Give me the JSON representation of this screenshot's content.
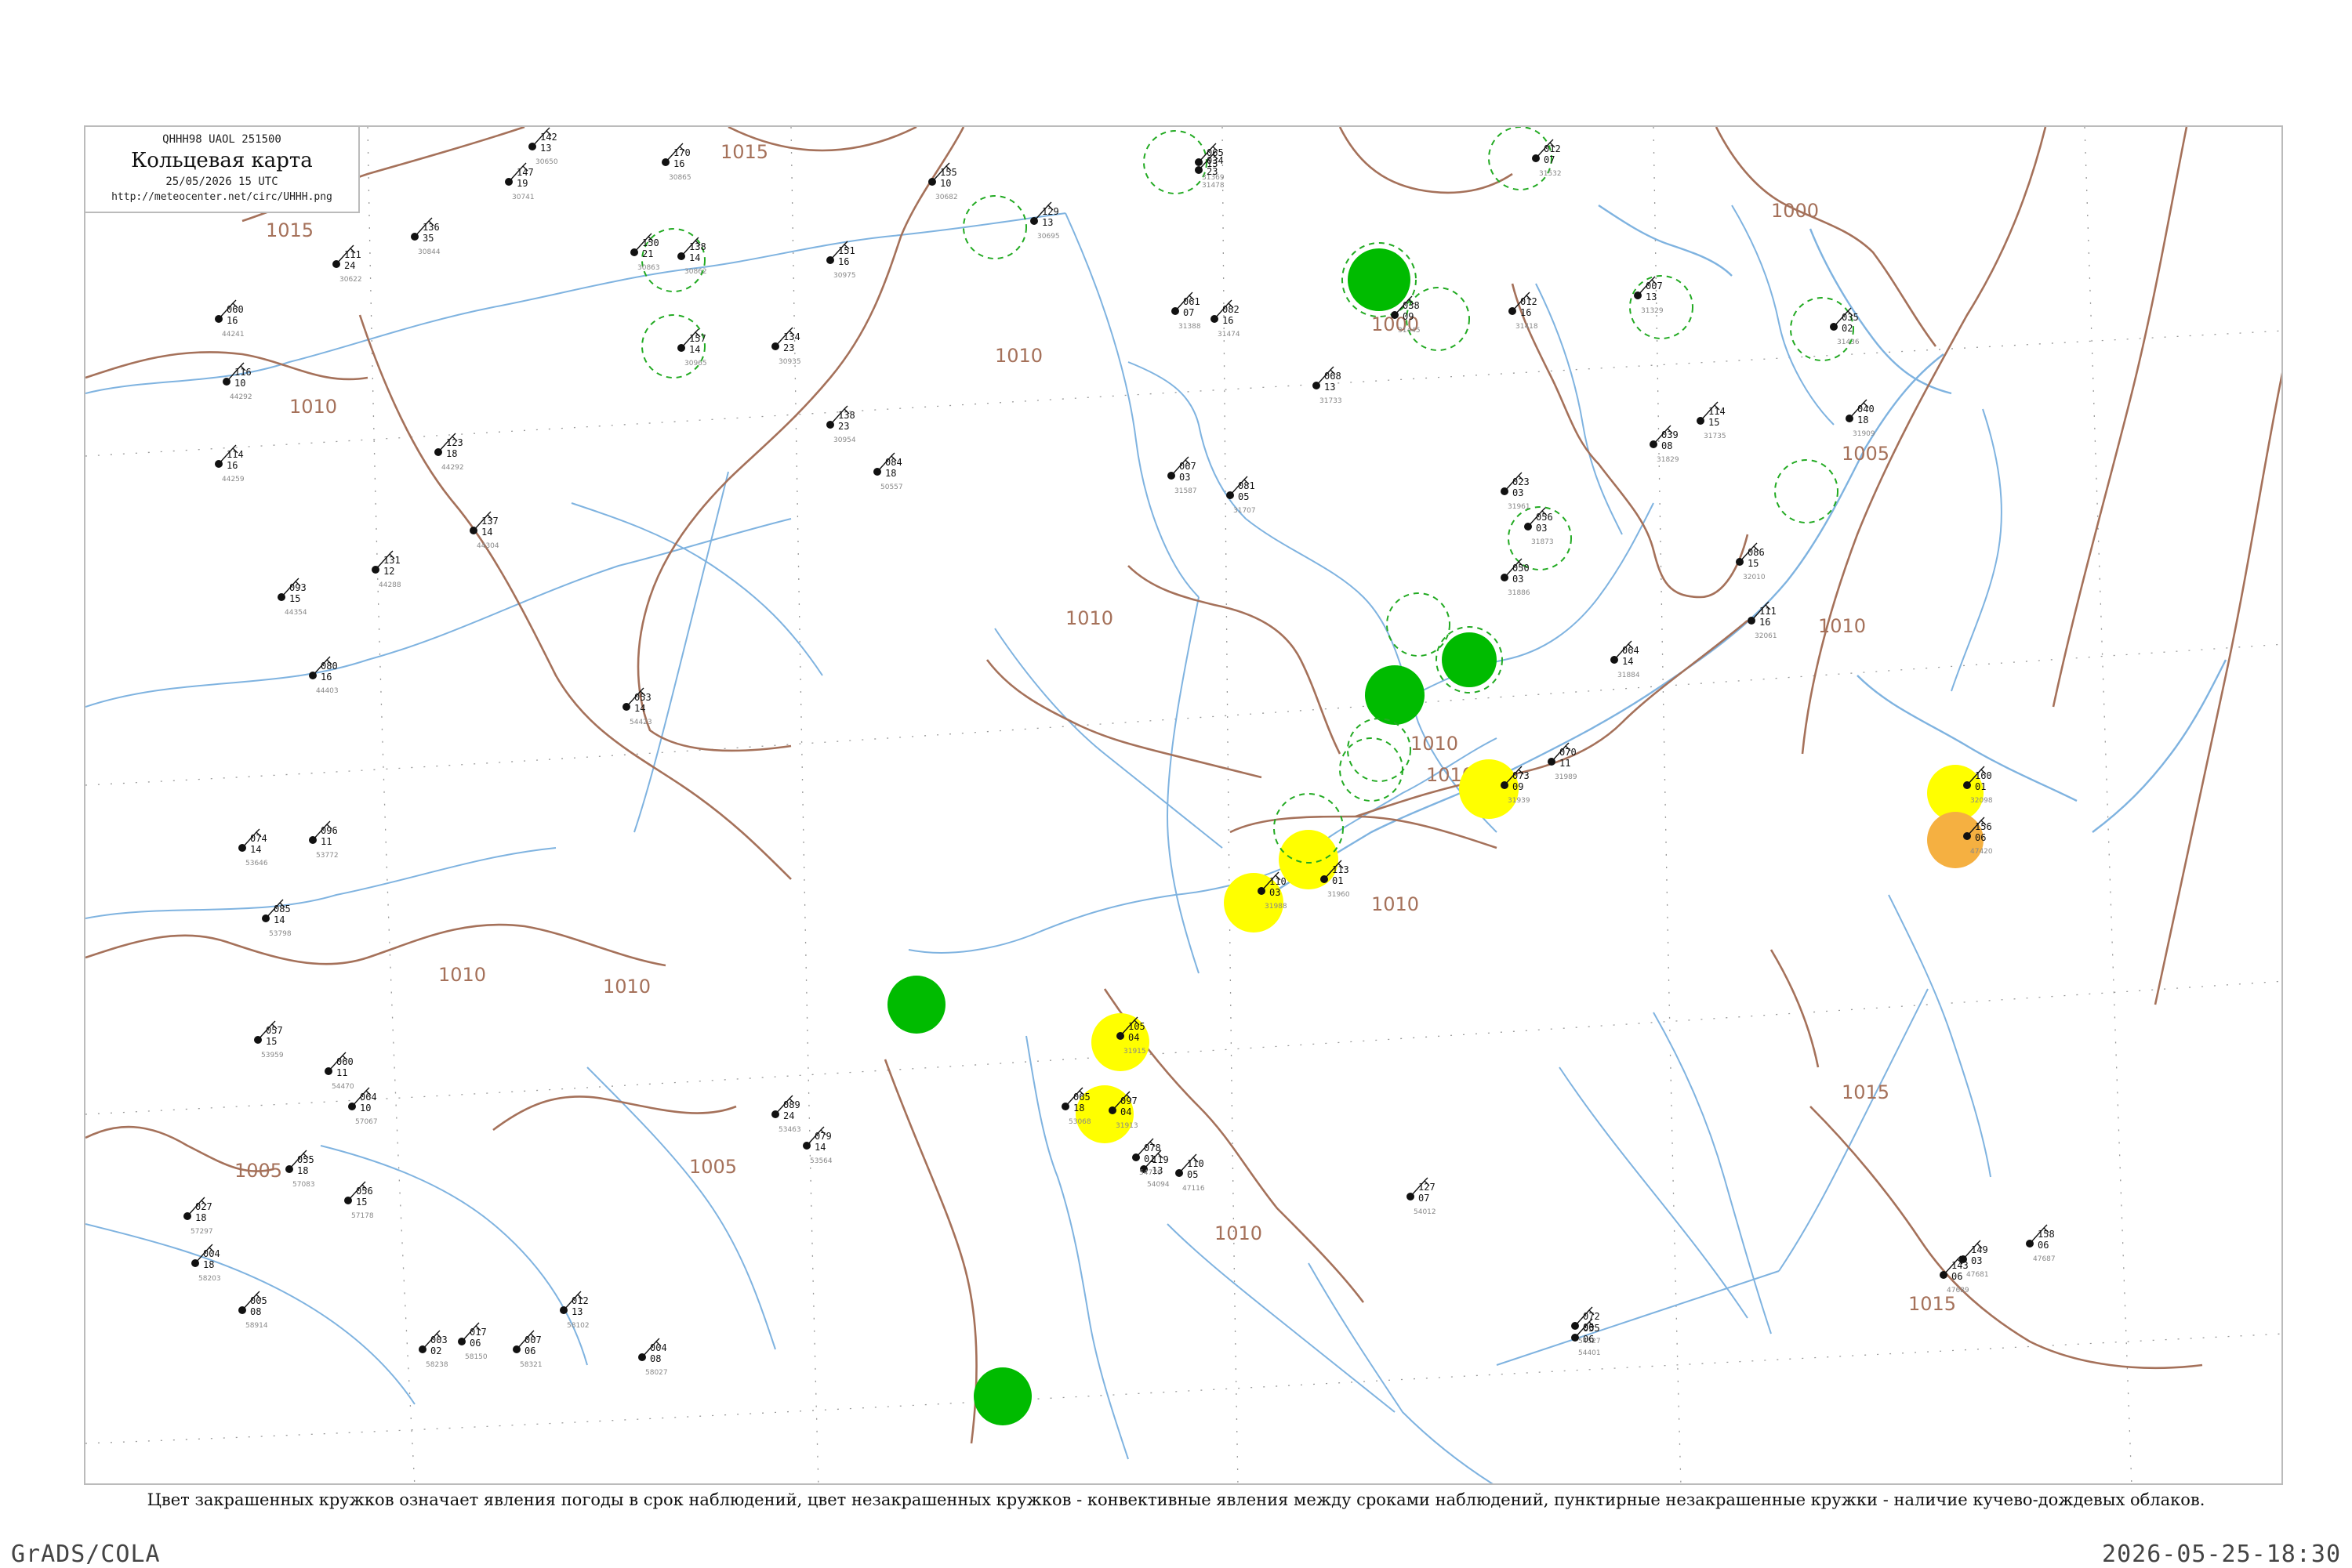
{
  "header": {
    "code": "QHHH98 UAOL 251500",
    "title": "Кольцевая карта",
    "date": "25/05/2026 15 UTC",
    "url": "http://meteocenter.net/circ/UHHH.png"
  },
  "caption": "Цвет закрашенных кружков означает явления погоды в срок наблюдений, цвет незакрашенных кружков - конвективные явления между сроками наблюдений, пунктирные незакрашенные кружки - наличие кучево-дождевых облаков.",
  "footer": {
    "left": "GrADS/COLA",
    "right": "2026-05-25-18:30"
  },
  "colors": {
    "isobar": "#a5715a",
    "water": "#7fb3e0",
    "rain_circle": "#00bb00",
    "shower_circle": "#ffff00",
    "thunder_circle": "#f5b041",
    "cb_circle": "#22aa22"
  },
  "isobars": [
    {
      "value": "1015"
    },
    {
      "value": "1015"
    },
    {
      "value": "1010"
    },
    {
      "value": "1010"
    },
    {
      "value": "1010"
    },
    {
      "value": "1010"
    },
    {
      "value": "1010"
    },
    {
      "value": "1005"
    },
    {
      "value": "1005"
    },
    {
      "value": "1005"
    },
    {
      "value": "1000"
    },
    {
      "value": "1000"
    },
    {
      "value": "1010"
    },
    {
      "value": "1010"
    },
    {
      "value": "1015"
    },
    {
      "value": "1015"
    },
    {
      "value": "1010"
    },
    {
      "value": "1010"
    },
    {
      "value": "1010"
    }
  ],
  "stations": [
    {
      "t": "142",
      "v": "13",
      "id": "30650"
    },
    {
      "t": "147",
      "v": "19",
      "id": "30741"
    },
    {
      "t": "170",
      "v": "16",
      "id": "30865"
    },
    {
      "t": "155",
      "v": "10",
      "id": "30682"
    },
    {
      "t": "129",
      "v": "13",
      "id": "30695"
    },
    {
      "t": "065",
      "v": "13",
      "id": "31369"
    },
    {
      "t": "034",
      "v": "23",
      "id": "31478"
    },
    {
      "t": "012",
      "v": "07",
      "id": "31532"
    },
    {
      "t": "136",
      "v": "35",
      "id": "30844"
    },
    {
      "t": "111",
      "v": "24",
      "id": "30622"
    },
    {
      "t": "150",
      "v": "21",
      "id": "30863"
    },
    {
      "t": "138",
      "v": "14",
      "id": "30862"
    },
    {
      "t": "157",
      "v": "14",
      "id": "30965"
    },
    {
      "t": "151",
      "v": "16",
      "id": "30975"
    },
    {
      "t": "134",
      "v": "23",
      "id": "30935"
    },
    {
      "t": "138",
      "v": "23",
      "id": "30954"
    },
    {
      "t": "061",
      "v": "07",
      "id": "31388"
    },
    {
      "t": "082",
      "v": "16",
      "id": "31474"
    },
    {
      "t": "038",
      "v": "09",
      "id": "31445"
    },
    {
      "t": "012",
      "v": "16",
      "id": "31418"
    },
    {
      "t": "007",
      "v": "13",
      "id": "31329"
    },
    {
      "t": "035",
      "v": "02",
      "id": "31436"
    },
    {
      "t": "060",
      "v": "16",
      "id": "44241"
    },
    {
      "t": "116",
      "v": "10",
      "id": "44292"
    },
    {
      "t": "114",
      "v": "16",
      "id": "44259"
    },
    {
      "t": "093",
      "v": "15",
      "id": "44354"
    },
    {
      "t": "080",
      "v": "16",
      "id": "44403"
    },
    {
      "t": "131",
      "v": "12",
      "id": "44288"
    },
    {
      "t": "123",
      "v": "18",
      "id": "44292"
    },
    {
      "t": "137",
      "v": "14",
      "id": "44304"
    },
    {
      "t": "084",
      "v": "18",
      "id": "50557"
    },
    {
      "t": "067",
      "v": "03",
      "id": "31587"
    },
    {
      "t": "081",
      "v": "05",
      "id": "31707"
    },
    {
      "t": "068",
      "v": "13",
      "id": "31733"
    },
    {
      "t": "039",
      "v": "08",
      "id": "31829"
    },
    {
      "t": "114",
      "v": "15",
      "id": "31735"
    },
    {
      "t": "040",
      "v": "18",
      "id": "31909"
    },
    {
      "t": "023",
      "v": "03",
      "id": "31961"
    },
    {
      "t": "056",
      "v": "03",
      "id": "31873"
    },
    {
      "t": "050",
      "v": "03",
      "id": "31886"
    },
    {
      "t": "064",
      "v": "14",
      "id": "31884"
    },
    {
      "t": "086",
      "v": "15",
      "id": "32010"
    },
    {
      "t": "111",
      "v": "16",
      "id": "32061"
    },
    {
      "t": "160",
      "v": "01",
      "id": "32098"
    },
    {
      "t": "156",
      "v": "06",
      "id": "47420"
    },
    {
      "t": "070",
      "v": "11",
      "id": "31989"
    },
    {
      "t": "073",
      "v": "09",
      "id": "31939"
    },
    {
      "t": "110",
      "v": "03",
      "id": "31988"
    },
    {
      "t": "113",
      "v": "01",
      "id": "31960"
    },
    {
      "t": "105",
      "v": "04",
      "id": "31915"
    },
    {
      "t": "097",
      "v": "04",
      "id": "31913"
    },
    {
      "t": "119",
      "v": "13",
      "id": "54094"
    },
    {
      "t": "078",
      "v": "01",
      "id": "54776"
    },
    {
      "t": "110",
      "v": "05",
      "id": "47116"
    },
    {
      "t": "149",
      "v": "03",
      "id": "47681"
    },
    {
      "t": "158",
      "v": "06",
      "id": "47687"
    },
    {
      "t": "143",
      "v": "06",
      "id": "47689"
    },
    {
      "t": "127",
      "v": "07",
      "id": "54012"
    },
    {
      "t": "072",
      "v": "06",
      "id": "54527"
    },
    {
      "t": "055",
      "v": "06",
      "id": "54401"
    },
    {
      "t": "053",
      "v": "14",
      "id": "54423"
    },
    {
      "t": "065",
      "v": "18",
      "id": "53068"
    },
    {
      "t": "089",
      "v": "24",
      "id": "53463"
    },
    {
      "t": "079",
      "v": "14",
      "id": "53564"
    },
    {
      "t": "074",
      "v": "14",
      "id": "53646"
    },
    {
      "t": "096",
      "v": "11",
      "id": "53772"
    },
    {
      "t": "085",
      "v": "14",
      "id": "53798"
    },
    {
      "t": "057",
      "v": "15",
      "id": "53959"
    },
    {
      "t": "060",
      "v": "11",
      "id": "54470"
    },
    {
      "t": "064",
      "v": "10",
      "id": "57067"
    },
    {
      "t": "055",
      "v": "18",
      "id": "57083"
    },
    {
      "t": "056",
      "v": "15",
      "id": "57178"
    },
    {
      "t": "027",
      "v": "18",
      "id": "57297"
    },
    {
      "t": "004",
      "v": "18",
      "id": "58203"
    },
    {
      "t": "005",
      "v": "08",
      "id": "58914"
    },
    {
      "t": "003",
      "v": "02",
      "id": "58238"
    },
    {
      "t": "007",
      "v": "06",
      "id": "58321"
    },
    {
      "t": "017",
      "v": "06",
      "id": "58150"
    },
    {
      "t": "004",
      "v": "08",
      "id": "58027"
    },
    {
      "t": "012",
      "v": "13",
      "id": "58102"
    }
  ]
}
